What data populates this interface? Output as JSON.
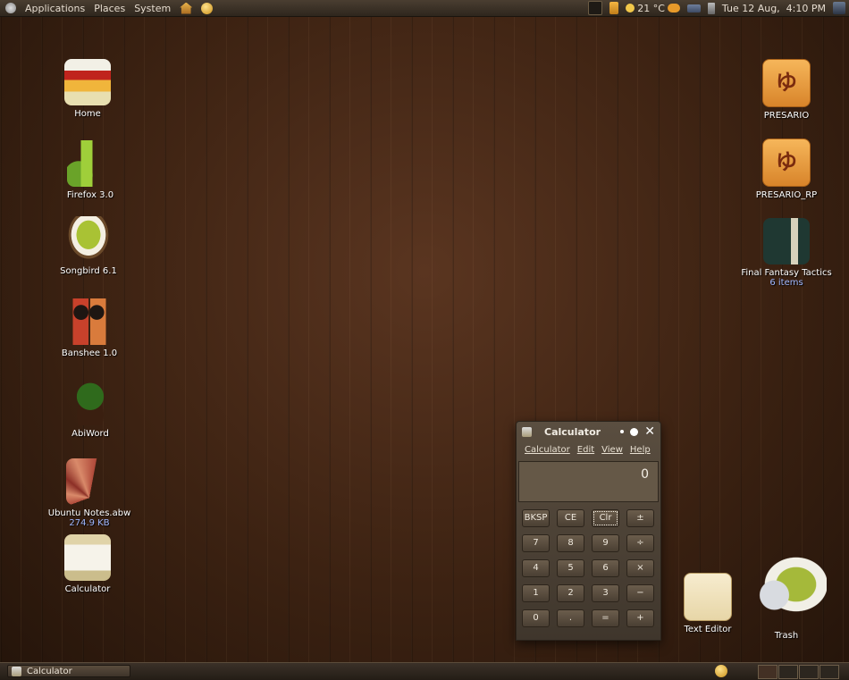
{
  "top_panel": {
    "menus": [
      "Applications",
      "Places",
      "System"
    ],
    "weather": "21 °C",
    "clock": "Tue 12 Aug,  4:10 PM"
  },
  "desktop_left": [
    {
      "label": "Home",
      "icon": "home-folder-icon"
    },
    {
      "label": "Firefox 3.0",
      "icon": "firefox-icon"
    },
    {
      "label": "Songbird 6.1",
      "icon": "songbird-icon"
    },
    {
      "label": "Banshee 1.0",
      "icon": "banshee-icon"
    },
    {
      "label": "AbiWord",
      "icon": "abiword-icon"
    },
    {
      "label": "Ubuntu Notes.abw",
      "sublabel": "274.9 KB",
      "icon": "document-icon"
    },
    {
      "label": "Calculator",
      "icon": "calculator-icon"
    }
  ],
  "desktop_right": [
    {
      "label": "PRESARIO",
      "icon": "drive-icon",
      "glyph": "ゆ"
    },
    {
      "label": "PRESARIO_RP",
      "icon": "drive-icon",
      "glyph": "ゆ"
    },
    {
      "label": "Final Fantasy Tactics",
      "sublabel": "6 items",
      "icon": "folder-icon"
    },
    {
      "label": "Text Editor",
      "icon": "text-editor-icon"
    },
    {
      "label": "Trash",
      "icon": "trash-icon"
    }
  ],
  "calculator": {
    "title": "Calculator",
    "menus": [
      "Calculator",
      "Edit",
      "View",
      "Help"
    ],
    "display": "0",
    "buttons": [
      "BKSP",
      "CE",
      "Clr",
      "±",
      "7",
      "8",
      "9",
      "÷",
      "4",
      "5",
      "6",
      "×",
      "1",
      "2",
      "3",
      "−",
      "0",
      ".",
      "=",
      "+"
    ]
  },
  "taskbar": {
    "task_label": "Calculator"
  }
}
